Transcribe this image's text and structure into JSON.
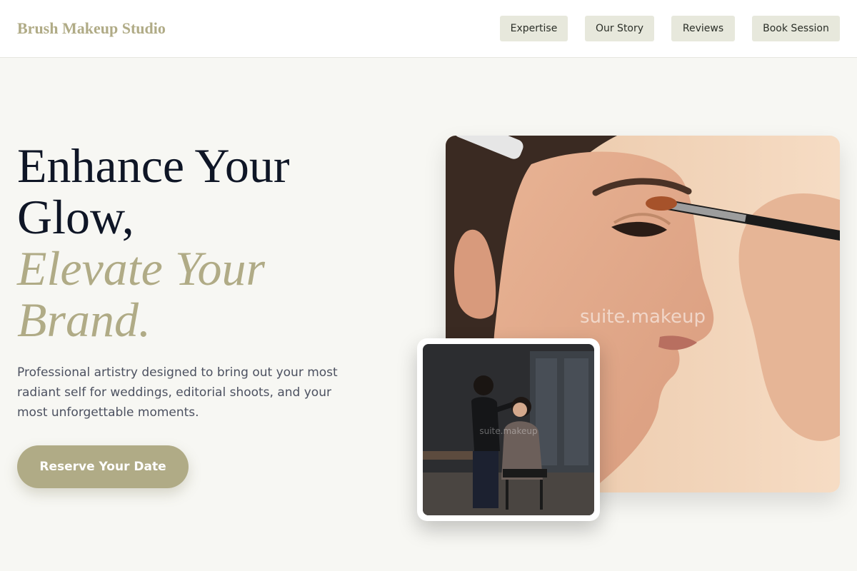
{
  "header": {
    "brand": "Brush Makeup Studio",
    "nav": [
      "Expertise",
      "Our Story",
      "Reviews",
      "Book Session"
    ]
  },
  "hero": {
    "headline_line1": "Enhance Your",
    "headline_line2": "Glow,",
    "headline_accent_line1": "Elevate Your",
    "headline_accent_line2": "Brand.",
    "description": "Professional artistry designed to bring out your most radiant self for weddings, editorial shoots, and your most unforgettable moments.",
    "cta_label": "Reserve Your Date"
  },
  "images": {
    "main_watermark": "suite.makeup",
    "inset_watermark": "suite.makeup"
  },
  "colors": {
    "accent": "#b0ab86",
    "headline": "#0f1626",
    "nav_button_bg": "#e7e8dc",
    "page_bg": "#f7f7f3"
  }
}
